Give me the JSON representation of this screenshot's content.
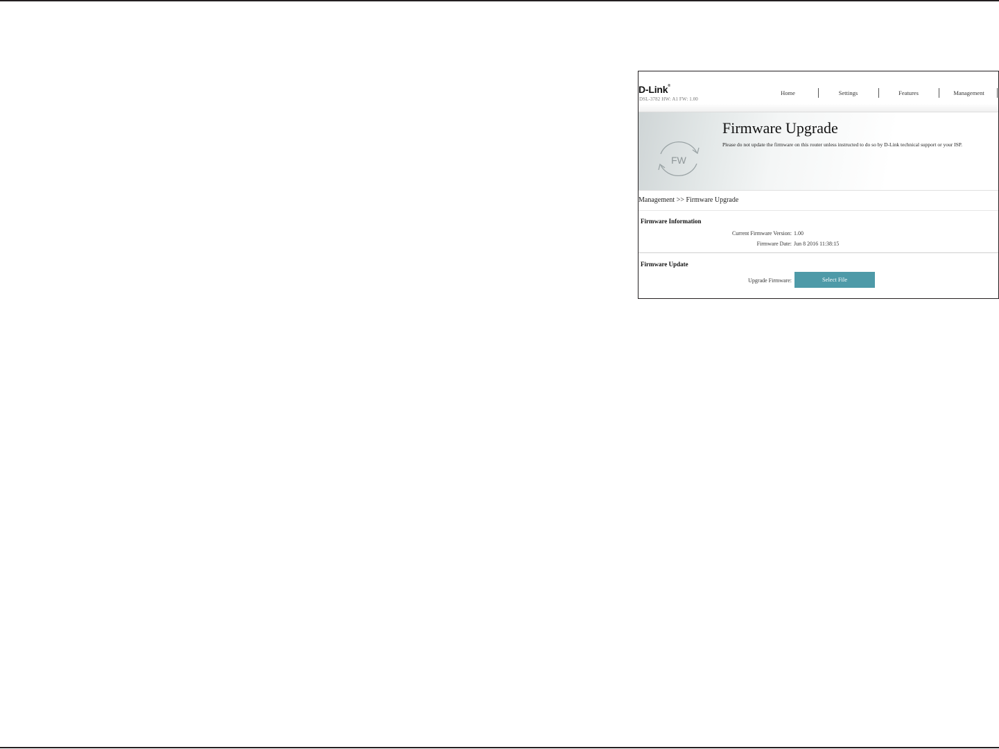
{
  "header": {
    "logo": "D-Link",
    "logo_mark": "®",
    "model_info": "DSL-3782 HW: A1 FW: 1.00",
    "nav": [
      "Home",
      "Settings",
      "Features",
      "Management"
    ]
  },
  "banner": {
    "icon_text": "FW",
    "title": "Firmware Upgrade",
    "description": "Please do not update the firmware on this router unless instructed to do so by D-Link technical support or your ISP."
  },
  "breadcrumb": "Management >> Firmware Upgrade",
  "firmware_info": {
    "title": "Firmware Information",
    "version_label": "Current Firmware Version:",
    "version_value": "1.00",
    "date_label": "Firmware Date:",
    "date_value": "Jun 8 2016 11:38:15"
  },
  "firmware_update": {
    "title": "Firmware Update",
    "upgrade_label": "Upgrade Firmware:",
    "select_button": "Select File"
  },
  "colors": {
    "button": "#4e9aa8"
  }
}
